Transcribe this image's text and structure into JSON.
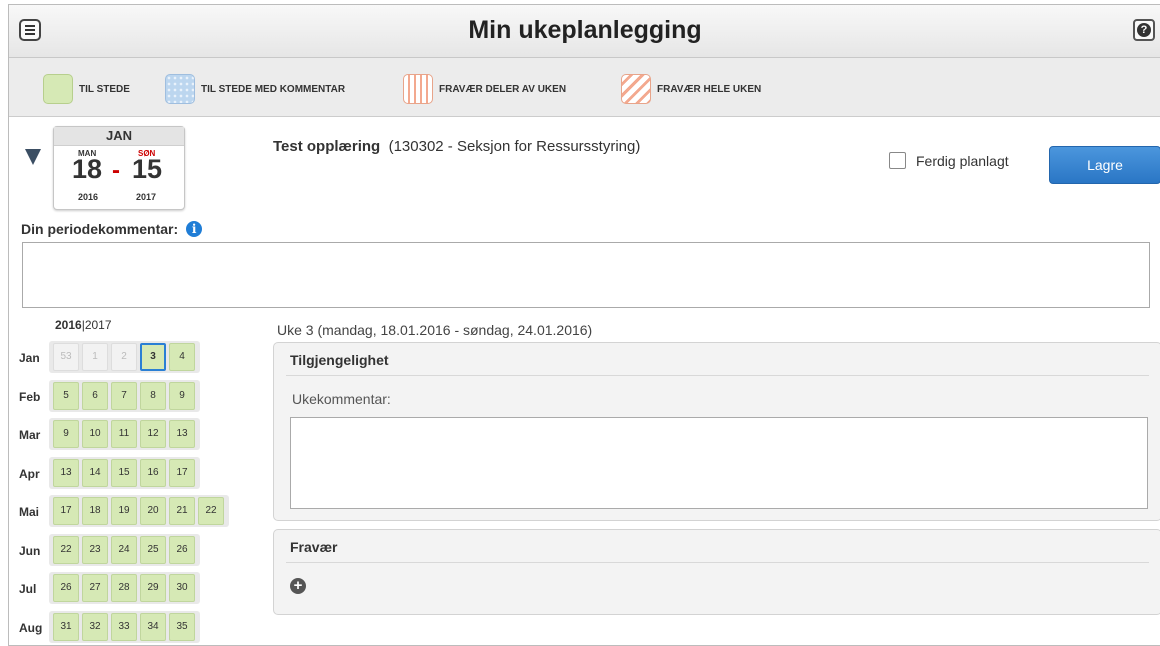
{
  "header": {
    "title": "Min ukeplanlegging"
  },
  "legend": [
    {
      "label": "TIL STEDE",
      "style": "green"
    },
    {
      "label": "TIL STEDE MED KOMMENTAR",
      "style": "blue-dotted"
    },
    {
      "label": "FRAVÆR DELER AV UKEN",
      "style": "orange-vertical"
    },
    {
      "label": "FRAVÆR HELE UKEN",
      "style": "orange-diagonal"
    }
  ],
  "period": {
    "month": "JAN",
    "start_day_label": "MAN",
    "end_day_label": "SØN",
    "start_day": "18",
    "dash": "-",
    "end_day": "15",
    "start_year": "2016",
    "end_year": "2017"
  },
  "course": {
    "name": "Test opplæring",
    "detail": "(130302 - Seksjon for Ressursstyring)"
  },
  "done_checkbox": {
    "label": "Ferdig planlagt",
    "checked": false
  },
  "save_label": "Lagre",
  "period_comment": {
    "label": "Din periodekommentar:",
    "info_icon": "i",
    "value": ""
  },
  "year_selector": {
    "active": "2016",
    "separator": "|",
    "other": "2017"
  },
  "weeks": [
    {
      "month": "Jan",
      "weeks": [
        "53",
        "1",
        "2",
        "3",
        "4"
      ],
      "disabled": [
        0,
        1,
        2
      ],
      "selected": 3
    },
    {
      "month": "Feb",
      "weeks": [
        "5",
        "6",
        "7",
        "8",
        "9"
      ]
    },
    {
      "month": "Mar",
      "weeks": [
        "9",
        "10",
        "11",
        "12",
        "13"
      ]
    },
    {
      "month": "Apr",
      "weeks": [
        "13",
        "14",
        "15",
        "16",
        "17"
      ]
    },
    {
      "month": "Mai",
      "weeks": [
        "17",
        "18",
        "19",
        "20",
        "21",
        "22"
      ]
    },
    {
      "month": "Jun",
      "weeks": [
        "22",
        "23",
        "24",
        "25",
        "26"
      ]
    },
    {
      "month": "Jul",
      "weeks": [
        "26",
        "27",
        "28",
        "29",
        "30"
      ]
    },
    {
      "month": "Aug",
      "weeks": [
        "31",
        "32",
        "33",
        "34",
        "35"
      ]
    }
  ],
  "week_detail": {
    "title": "Uke 3 (mandag, 18.01.2016 - søndag, 24.01.2016)",
    "availability_heading": "Tilgjengelighet",
    "week_comment_label": "Ukekommentar:",
    "week_comment_value": "",
    "absence_heading": "Fravær"
  },
  "colors": {
    "accent": "#2a76c5",
    "present": "#d6e9b5",
    "absence": "#f3a98f"
  }
}
